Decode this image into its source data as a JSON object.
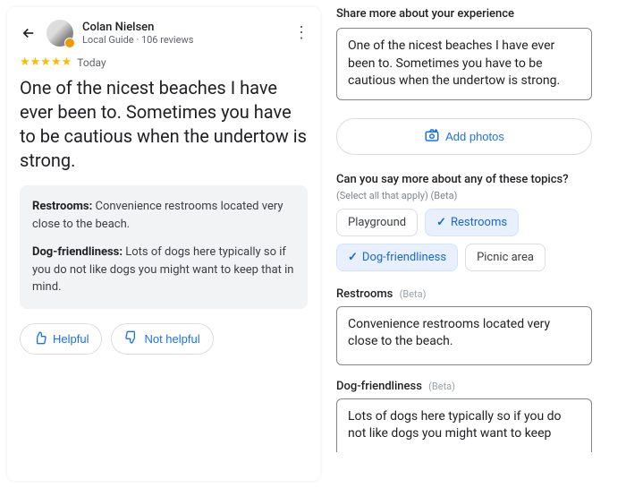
{
  "left": {
    "user_name": "Colan Nielsen",
    "user_sub": "Local Guide · 106 reviews",
    "stars_text": "★★★★★",
    "when": "Today",
    "review_body": "One of the nicest beaches I have ever been to. Sometimes you have to be cautious when the undertow is strong.",
    "details": {
      "restrooms_label": "Restrooms:",
      "restrooms_body": " Convenience restrooms located very close to the beach.",
      "dogs_label": "Dog-friendliness:",
      "dogs_body": " Lots of dogs here typically so if you do not like dogs you might want to keep that in mind."
    },
    "helpful_label": "Helpful",
    "not_helpful_label": "Not helpful"
  },
  "right": {
    "share_title": "Share more about your experience",
    "experience_text": "One of the nicest beaches I have ever been to. Sometimes you have to be cautious when the undertow is strong.",
    "add_photos_label": "Add photos",
    "topics_title": "Can you say more about any of these topics?",
    "topics_sub": "(Select all that apply)  (Beta)",
    "chips": {
      "playground": "Playground",
      "restrooms": "Restrooms",
      "dogs": "Dog-friendliness",
      "picnic": "Picnic area"
    },
    "restrooms_label": "Restrooms",
    "restrooms_text": "Convenience restrooms located very close to the beach.",
    "dogs_label": "Dog-friendliness",
    "dogs_text": "Lots of dogs here typically so if you do not like dogs you might want to keep",
    "beta": "(Beta)"
  }
}
